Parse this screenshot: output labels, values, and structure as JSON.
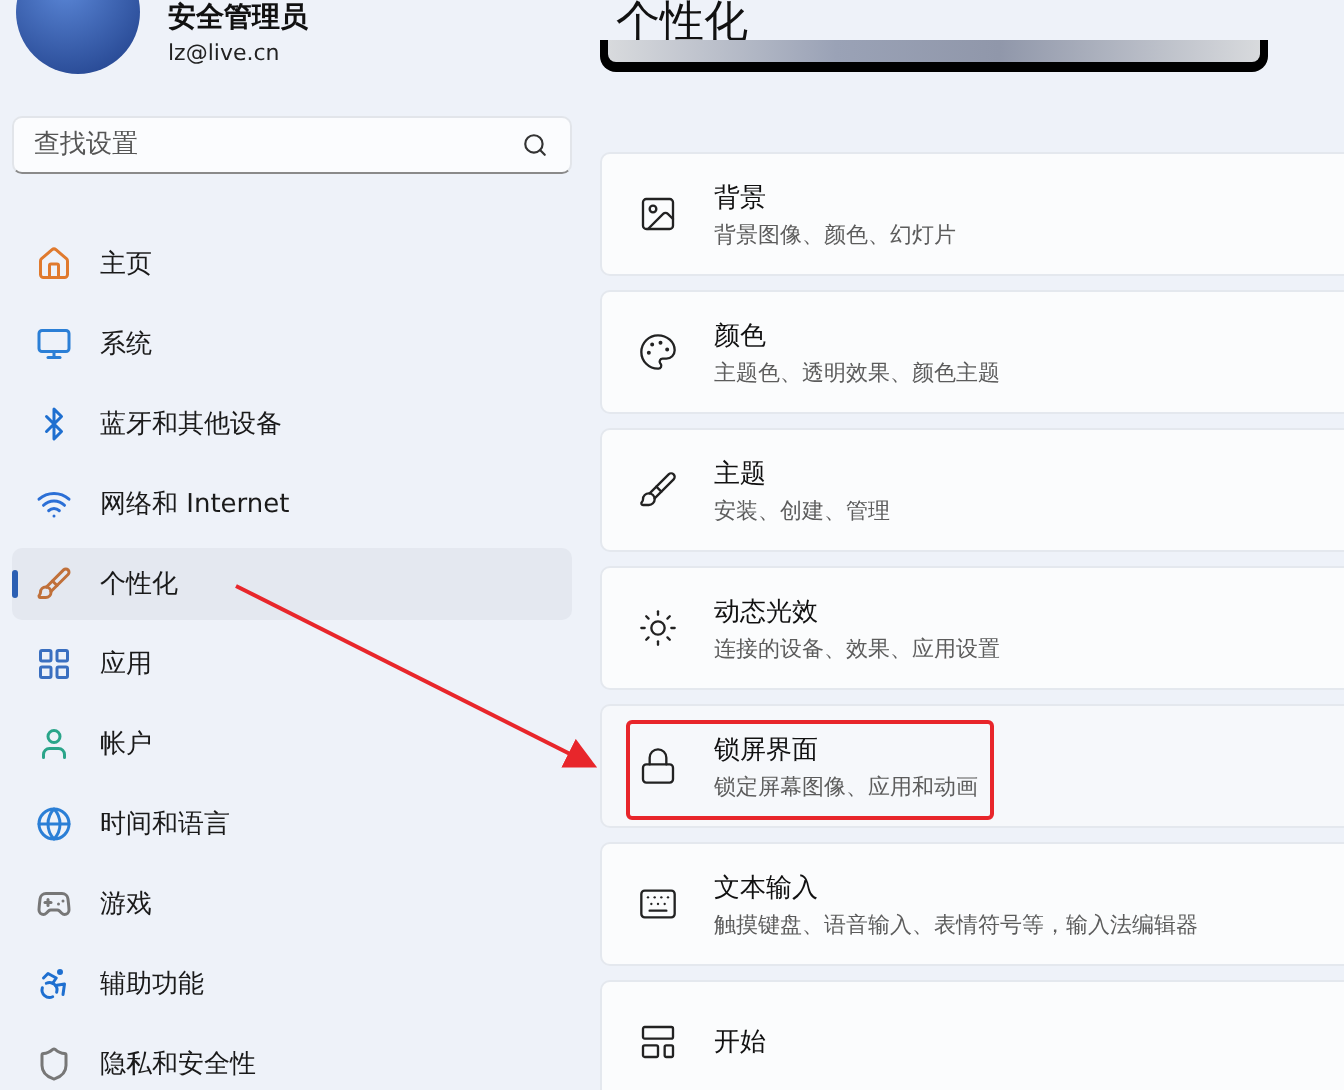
{
  "user": {
    "name": "安全管理员",
    "email": "lz@live.cn"
  },
  "search": {
    "placeholder": "查找设置"
  },
  "nav": [
    {
      "label": "主页",
      "kind": "home",
      "selected": false
    },
    {
      "label": "系统",
      "kind": "system",
      "selected": false
    },
    {
      "label": "蓝牙和其他设备",
      "kind": "bluetooth",
      "selected": false
    },
    {
      "label": "网络和 Internet",
      "kind": "network",
      "selected": false
    },
    {
      "label": "个性化",
      "kind": "personalize",
      "selected": true
    },
    {
      "label": "应用",
      "kind": "apps",
      "selected": false
    },
    {
      "label": "帐户",
      "kind": "account",
      "selected": false
    },
    {
      "label": "时间和语言",
      "kind": "time",
      "selected": false
    },
    {
      "label": "游戏",
      "kind": "gaming",
      "selected": false
    },
    {
      "label": "辅助功能",
      "kind": "accessibility",
      "selected": false
    },
    {
      "label": "隐私和安全性",
      "kind": "privacy",
      "selected": false
    }
  ],
  "page_title": "个性化",
  "cards": [
    {
      "title": "背景",
      "subtitle": "背景图像、颜色、幻灯片",
      "kind": "background",
      "highlighted": false
    },
    {
      "title": "颜色",
      "subtitle": "主题色、透明效果、颜色主题",
      "kind": "colors",
      "highlighted": false
    },
    {
      "title": "主题",
      "subtitle": "安装、创建、管理",
      "kind": "themes",
      "highlighted": false
    },
    {
      "title": "动态光效",
      "subtitle": "连接的设备、效果、应用设置",
      "kind": "lighting",
      "highlighted": false
    },
    {
      "title": "锁屏界面",
      "subtitle": "锁定屏幕图像、应用和动画",
      "kind": "lockscreen",
      "highlighted": true
    },
    {
      "title": "文本输入",
      "subtitle": "触摸键盘、语音输入、表情符号等，输入法编辑器",
      "kind": "textinput",
      "highlighted": false
    },
    {
      "title": "开始",
      "kind": "start",
      "highlighted": false
    }
  ]
}
